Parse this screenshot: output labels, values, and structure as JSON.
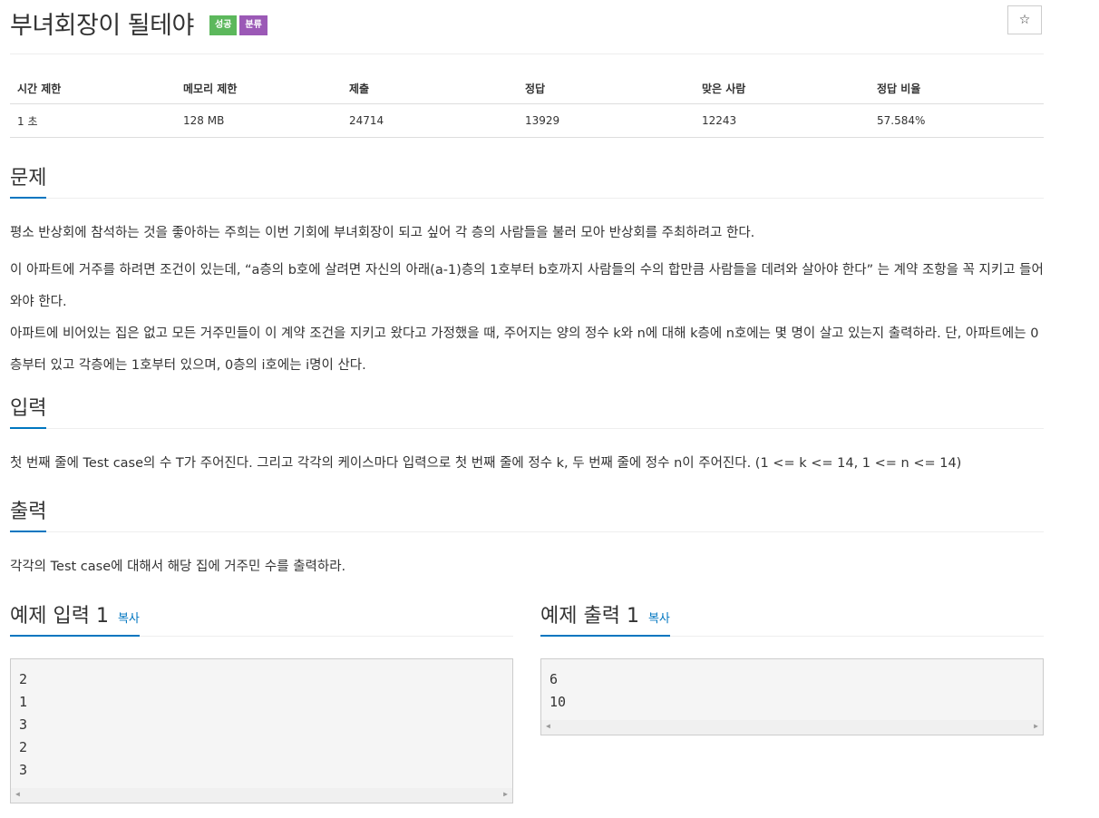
{
  "header": {
    "title": "부녀회장이 될테야",
    "badges": [
      "성공",
      "분류"
    ],
    "star_icon": "☆"
  },
  "stats": {
    "headers": [
      "시간 제한",
      "메모리 제한",
      "제출",
      "정답",
      "맞은 사람",
      "정답 비율"
    ],
    "values": [
      "1 초",
      "128 MB",
      "24714",
      "13929",
      "12243",
      "57.584%"
    ]
  },
  "sections": {
    "problem": {
      "title": "문제",
      "paragraphs": [
        "평소 반상회에 참석하는 것을 좋아하는 주희는 이번 기회에 부녀회장이 되고 싶어 각 층의 사람들을 불러 모아 반상회를 주최하려고 한다.",
        "이 아파트에 거주를 하려면 조건이 있는데, “a층의 b호에 살려면 자신의 아래(a-1)층의 1호부터 b호까지 사람들의 수의 합만큼 사람들을 데려와 살아야 한다” 는 계약 조항을 꼭 지키고 들어와야 한다.",
        "아파트에 비어있는 집은 없고 모든 거주민들이 이 계약 조건을 지키고 왔다고 가정했을 때, 주어지는 양의 정수 k와 n에 대해 k층에 n호에는 몇 명이 살고 있는지 출력하라. 단, 아파트에는 0층부터 있고 각층에는 1호부터 있으며, 0층의 i호에는 i명이 산다."
      ]
    },
    "input": {
      "title": "입력",
      "text": "첫 번째 줄에 Test case의 수 T가 주어진다. 그리고 각각의 케이스마다 입력으로 첫 번째 줄에 정수 k, 두 번째 줄에 정수 n이 주어진다. (1 <= k <= 14, 1 <= n <= 14)"
    },
    "output": {
      "title": "출력",
      "text": "각각의 Test case에 대해서 해당 집에 거주민 수를 출력하라."
    }
  },
  "samples": {
    "input": {
      "title": "예제 입력 1",
      "copy_label": "복사",
      "content": "2\n1\n3\n2\n3"
    },
    "output": {
      "title": "예제 출력 1",
      "copy_label": "복사",
      "content": "6\n10"
    }
  }
}
